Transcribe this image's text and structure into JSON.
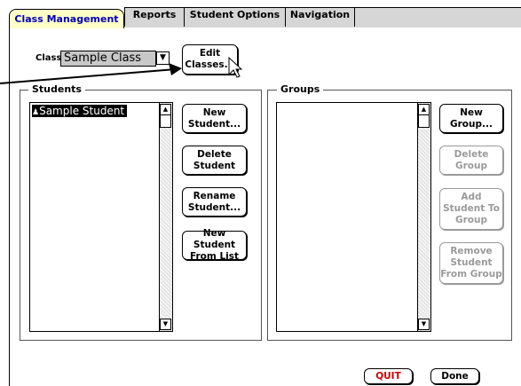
{
  "tabs": [
    {
      "label": "Class Management",
      "active": true
    },
    {
      "label": "Reports"
    },
    {
      "label": "Student Options"
    },
    {
      "label": "Navigation"
    }
  ],
  "class_selector": {
    "label": "Class",
    "value": "Sample Class"
  },
  "edit_classes_button": {
    "line1": "Edit",
    "line2": "Classes..."
  },
  "students": {
    "title": "Students",
    "items": [
      "Sample Student"
    ],
    "buttons": [
      {
        "line1": "New",
        "line2": "Student..."
      },
      {
        "line1": "Delete",
        "line2": "Student"
      },
      {
        "line1": "Rename",
        "line2": "Student..."
      },
      {
        "line1": "New Student",
        "line2": "From List"
      }
    ]
  },
  "groups": {
    "title": "Groups",
    "items": [],
    "buttons": [
      {
        "line1": "New",
        "line2": "Group...",
        "enabled": true
      },
      {
        "line1": "Delete",
        "line2": "Group",
        "enabled": false
      },
      {
        "line1": "Add",
        "line2": "Student To",
        "line3": "Group",
        "enabled": false
      },
      {
        "line1": "Remove",
        "line2": "Student",
        "line3": "From Group",
        "enabled": false
      }
    ]
  },
  "footer": {
    "quit_label": "QUIT",
    "done_label": "Done"
  },
  "colors": {
    "active_tab_bg": "#ffffc8",
    "active_tab_text": "#0000b4",
    "quit_text": "#d00000",
    "disabled_text": "#9a9a9a"
  }
}
